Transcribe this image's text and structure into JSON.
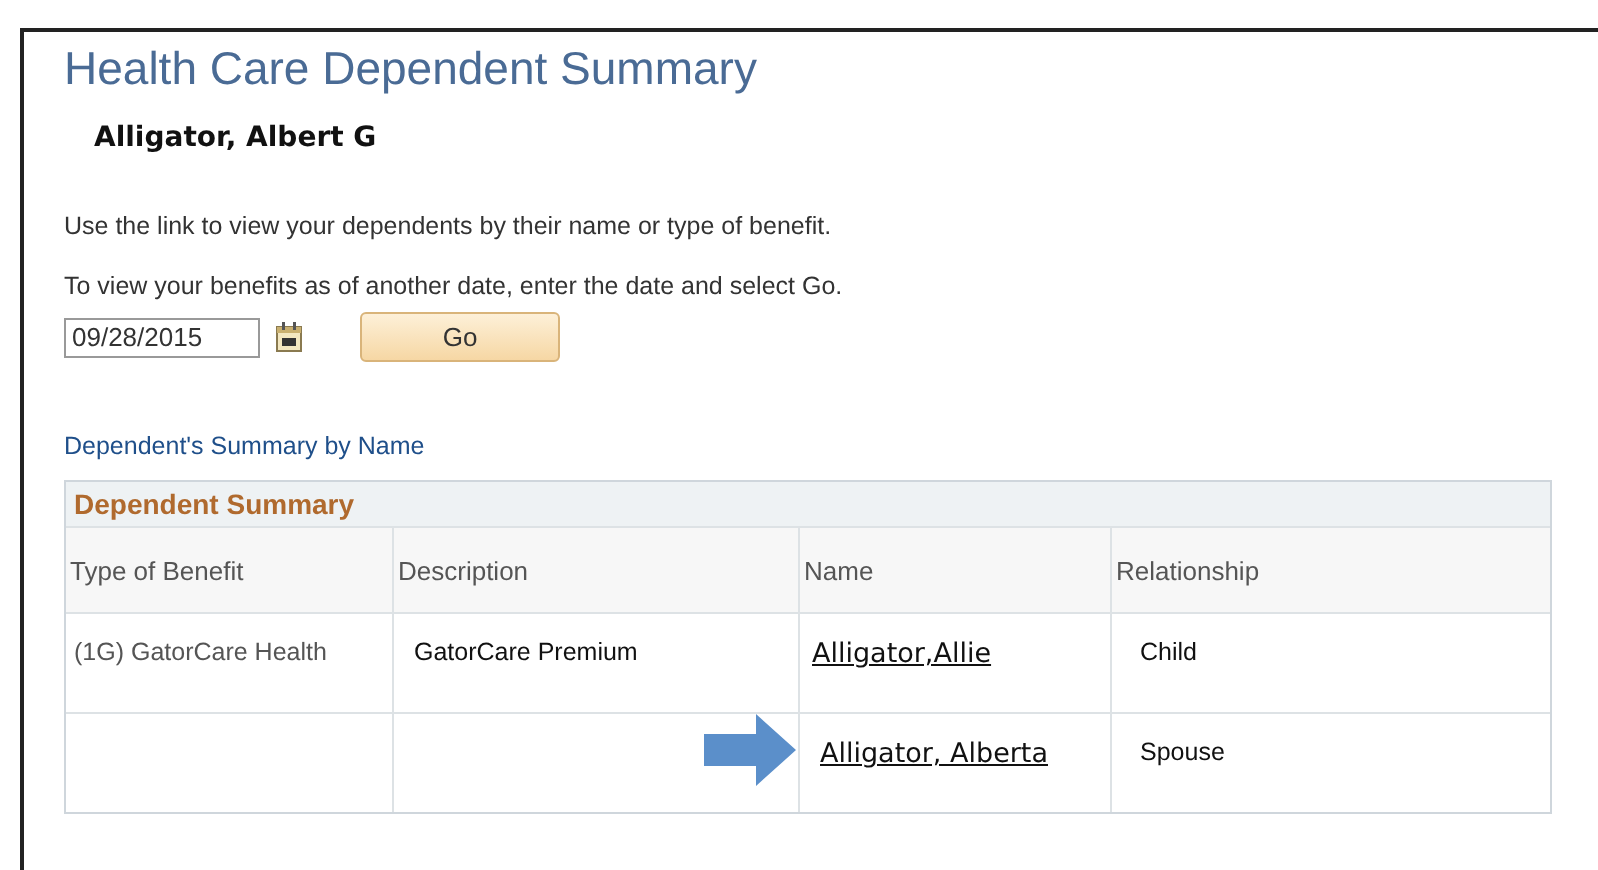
{
  "title": "Health Care Dependent Summary",
  "employee_name": "Alligator, Albert G",
  "instructions": [
    "Use the link to view your dependents by their name or type of benefit.",
    "To view your benefits as of another date, enter the date and select Go."
  ],
  "date_field": {
    "value": "09/28/2015"
  },
  "go_button": "Go",
  "view_link": "Dependent's Summary by Name",
  "grid": {
    "title": "Dependent Summary",
    "columns": [
      "Type of Benefit",
      "Description",
      "Name",
      "Relationship"
    ],
    "rows": [
      {
        "type_of_benefit": "(1G) GatorCare Health",
        "description": "GatorCare Premium",
        "name": "Alligator,Allie",
        "relationship": "Child",
        "highlighted": false
      },
      {
        "type_of_benefit": "",
        "description": "",
        "name": "Alligator, Alberta",
        "relationship": "Spouse",
        "highlighted": true
      }
    ]
  }
}
